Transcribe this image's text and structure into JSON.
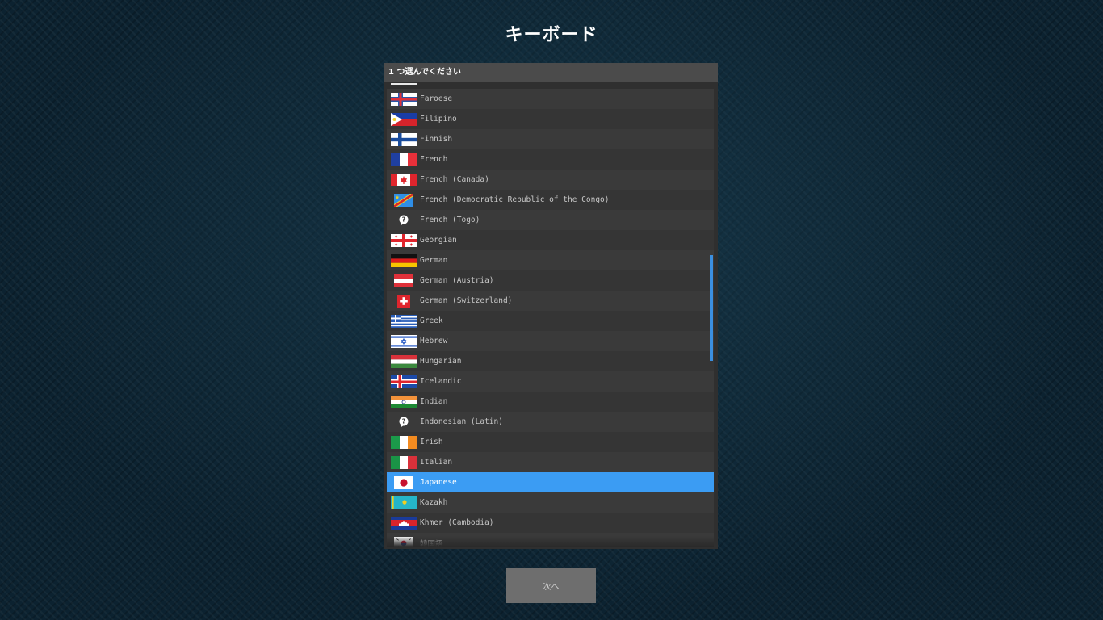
{
  "title": "キーボード",
  "list": {
    "header": "1 つ選んでください",
    "items": [
      {
        "label": "Faroese",
        "flag": "faroe-islands-flag-icon"
      },
      {
        "label": "Filipino",
        "flag": "philippines-flag-icon"
      },
      {
        "label": "Finnish",
        "flag": "finland-flag-icon"
      },
      {
        "label": "French",
        "flag": "france-flag-icon"
      },
      {
        "label": "French (Canada)",
        "flag": "canada-flag-icon"
      },
      {
        "label": "French (Democratic Republic of the Congo)",
        "flag": "dr-congo-flag-icon"
      },
      {
        "label": "French (Togo)",
        "flag": "unknown-flag-icon"
      },
      {
        "label": "Georgian",
        "flag": "georgia-flag-icon"
      },
      {
        "label": "German",
        "flag": "germany-flag-icon"
      },
      {
        "label": "German (Austria)",
        "flag": "austria-flag-icon"
      },
      {
        "label": "German (Switzerland)",
        "flag": "switzerland-flag-icon"
      },
      {
        "label": "Greek",
        "flag": "greece-flag-icon"
      },
      {
        "label": "Hebrew",
        "flag": "israel-flag-icon"
      },
      {
        "label": "Hungarian",
        "flag": "hungary-flag-icon"
      },
      {
        "label": "Icelandic",
        "flag": "iceland-flag-icon"
      },
      {
        "label": "Indian",
        "flag": "india-flag-icon"
      },
      {
        "label": "Indonesian (Latin)",
        "flag": "unknown-flag-icon"
      },
      {
        "label": "Irish",
        "flag": "ireland-flag-icon"
      },
      {
        "label": "Italian",
        "flag": "italy-flag-icon"
      },
      {
        "label": "Japanese",
        "flag": "japan-flag-icon",
        "selected": true
      },
      {
        "label": "Kazakh",
        "flag": "kazakhstan-flag-icon"
      },
      {
        "label": "Khmer (Cambodia)",
        "flag": "cambodia-flag-icon"
      },
      {
        "label": "韓国語",
        "flag": "south-korea-flag-icon"
      }
    ]
  },
  "next_button": {
    "label": "次へ"
  },
  "colors": {
    "selected": "#3b9cf3",
    "scrollbar": "#3b8fe0",
    "header": "#4b4b4b"
  }
}
